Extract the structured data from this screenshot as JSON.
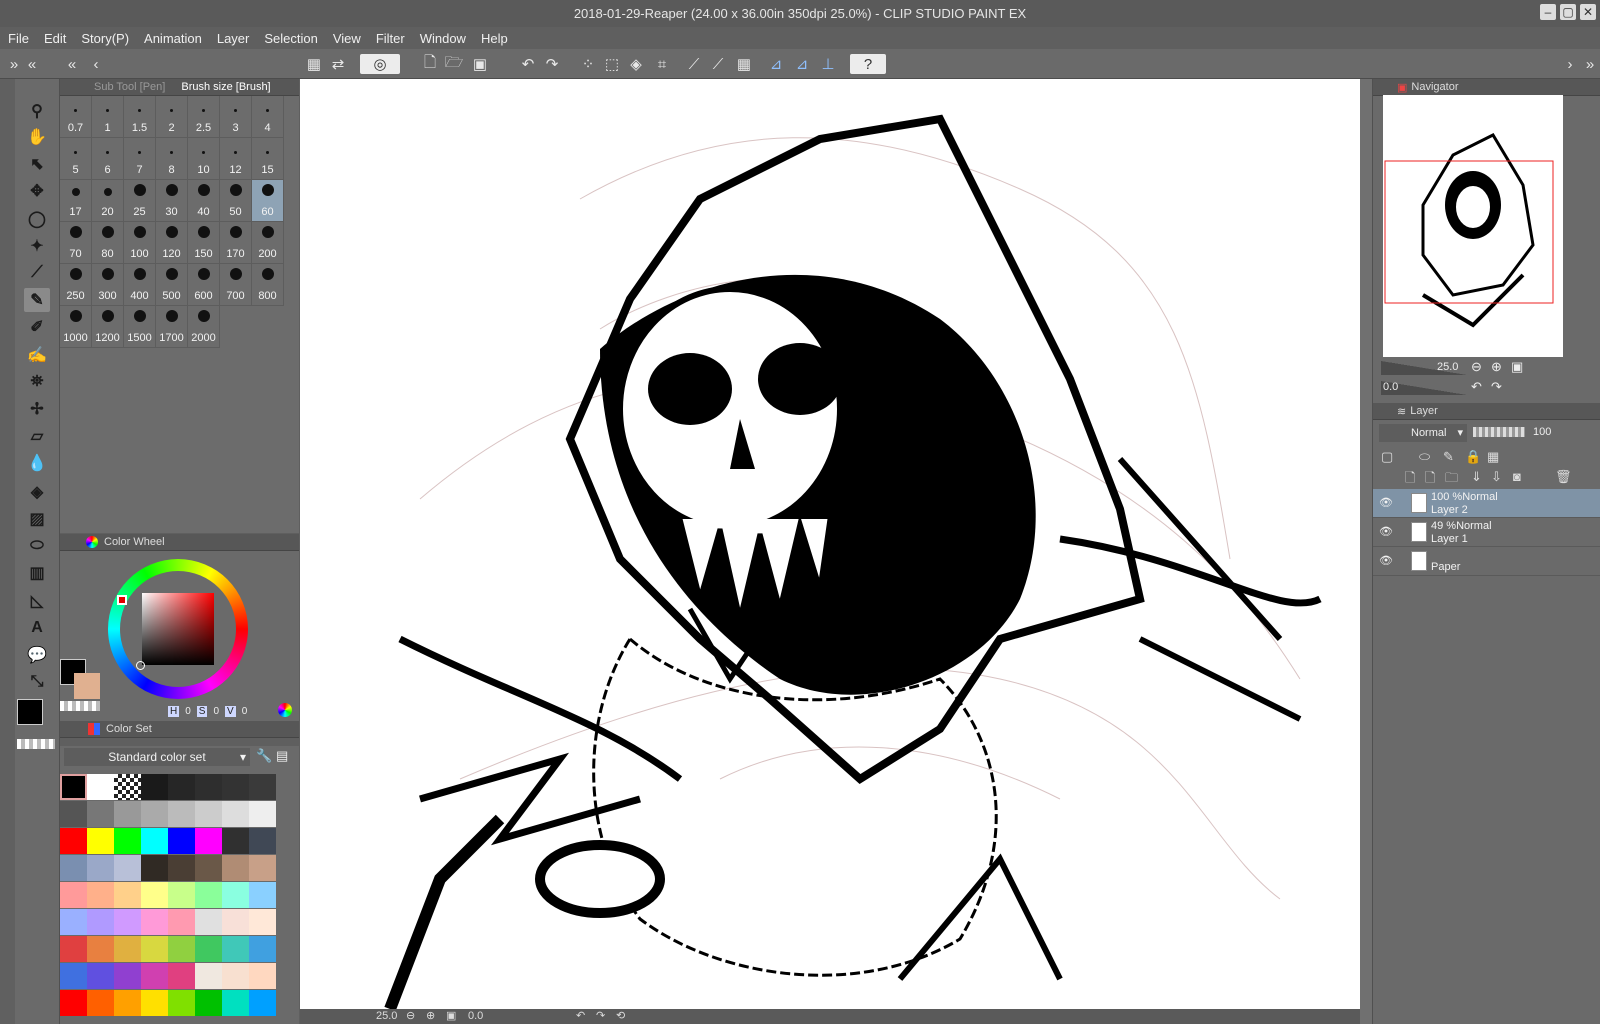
{
  "window": {
    "title": "2018-01-29-Reaper (24.00 x 36.00in 350dpi 25.0%)  - CLIP STUDIO PAINT EX"
  },
  "menu": [
    "File",
    "Edit",
    "Story(P)",
    "Animation",
    "Layer",
    "Selection",
    "View",
    "Filter",
    "Window",
    "Help"
  ],
  "subtool_panel": {
    "tab_pen": "Sub Tool [Pen]",
    "tab_brush": "Brush size [Brush]"
  },
  "brush_sizes": [
    {
      "value": "0.7",
      "dot": "tiny"
    },
    {
      "value": "1",
      "dot": "tiny"
    },
    {
      "value": "1.5",
      "dot": "tiny"
    },
    {
      "value": "2",
      "dot": "tiny"
    },
    {
      "value": "2.5",
      "dot": "tiny"
    },
    {
      "value": "3",
      "dot": "tiny"
    },
    {
      "value": "4",
      "dot": "tiny"
    },
    {
      "value": "5",
      "dot": "tiny"
    },
    {
      "value": "6",
      "dot": "tiny"
    },
    {
      "value": "7",
      "dot": "tiny"
    },
    {
      "value": "8",
      "dot": "tiny"
    },
    {
      "value": "10",
      "dot": "tiny"
    },
    {
      "value": "12",
      "dot": "tiny"
    },
    {
      "value": "15",
      "dot": "tiny"
    },
    {
      "value": "17",
      "dot": "med"
    },
    {
      "value": "20",
      "dot": "med"
    },
    {
      "value": "25",
      "dot": "large"
    },
    {
      "value": "30",
      "dot": "large"
    },
    {
      "value": "40",
      "dot": "large"
    },
    {
      "value": "50",
      "dot": "large"
    },
    {
      "value": "60",
      "dot": "large",
      "selected": true
    },
    {
      "value": "70",
      "dot": "large"
    },
    {
      "value": "80",
      "dot": "large"
    },
    {
      "value": "100",
      "dot": "large"
    },
    {
      "value": "120",
      "dot": "large"
    },
    {
      "value": "150",
      "dot": "large"
    },
    {
      "value": "170",
      "dot": "large"
    },
    {
      "value": "200",
      "dot": "large"
    },
    {
      "value": "250",
      "dot": "large"
    },
    {
      "value": "300",
      "dot": "large"
    },
    {
      "value": "400",
      "dot": "large"
    },
    {
      "value": "500",
      "dot": "large"
    },
    {
      "value": "600",
      "dot": "large"
    },
    {
      "value": "700",
      "dot": "large"
    },
    {
      "value": "800",
      "dot": "large"
    },
    {
      "value": "1000",
      "dot": "large"
    },
    {
      "value": "1200",
      "dot": "large"
    },
    {
      "value": "1500",
      "dot": "large"
    },
    {
      "value": "1700",
      "dot": "large"
    },
    {
      "value": "2000",
      "dot": "large"
    }
  ],
  "color_wheel": {
    "title": "Color Wheel",
    "h_label": "H",
    "h_value": "0",
    "s_label": "S",
    "s_value": "0",
    "v_label": "V",
    "v_value": "0"
  },
  "colors": {
    "main": "#000000",
    "sub": "#e0b090",
    "accent": "#8ea3b5"
  },
  "color_set": {
    "title": "Color Set",
    "set_name": "Standard color set",
    "swatches": [
      [
        "#000000",
        "#ffffff",
        "checker",
        "#1a1a1a",
        "#262626",
        "#2e2e2e",
        "#333333",
        "#3a3a3a"
      ],
      [
        "#555555",
        "#777777",
        "#999999",
        "#aaaaaa",
        "#bbbbbb",
        "#cccccc",
        "#dddddd",
        "#eeeeee"
      ],
      [
        "#ff0000",
        "#ffff00",
        "#00ff00",
        "#00ffff",
        "#0000ff",
        "#ff00ff",
        "#303030",
        "#404855"
      ],
      [
        "#7a8fb0",
        "#9aa8c8",
        "#b8c0d8",
        "#302a24",
        "#4a3e34",
        "#6a5848",
        "#b08c74",
        "#c8a088"
      ],
      [
        "#ff9a9a",
        "#ffb08a",
        "#ffd08a",
        "#ffff8a",
        "#c8ff8a",
        "#8aff9a",
        "#8affe0",
        "#8ad0ff"
      ],
      [
        "#9ab0ff",
        "#b09aff",
        "#d09aff",
        "#ff9ad8",
        "#ff9ab0",
        "#e0e0e0",
        "#f8e0d8",
        "#ffe8d8"
      ],
      [
        "#e04040",
        "#e88040",
        "#e0b040",
        "#d8d840",
        "#90d040",
        "#40c860",
        "#40c8b8",
        "#40a0e0"
      ],
      [
        "#4070e0",
        "#6050e0",
        "#9040d0",
        "#d040b0",
        "#e04080",
        "#f0e8e0",
        "#f8e0d0",
        "#ffd8c0"
      ],
      [
        "#ff0000",
        "#ff6000",
        "#ffa000",
        "#ffe000",
        "#80e000",
        "#00c000",
        "#00e0c0",
        "#00a0ff"
      ]
    ]
  },
  "navigator": {
    "title": "Navigator",
    "zoom": "25.0",
    "rotation": "0.0"
  },
  "layer_panel": {
    "title": "Layer",
    "blend_mode": "Normal",
    "opacity": "100",
    "layers": [
      {
        "info": "100 %Normal",
        "name": "Layer 2",
        "selected": true
      },
      {
        "info": "49 %Normal",
        "name": "Layer 1",
        "selected": false
      },
      {
        "info": "",
        "name": "Paper",
        "selected": false
      }
    ]
  },
  "statusbar": {
    "zoom": "25.0",
    "rotation": "0.0"
  }
}
